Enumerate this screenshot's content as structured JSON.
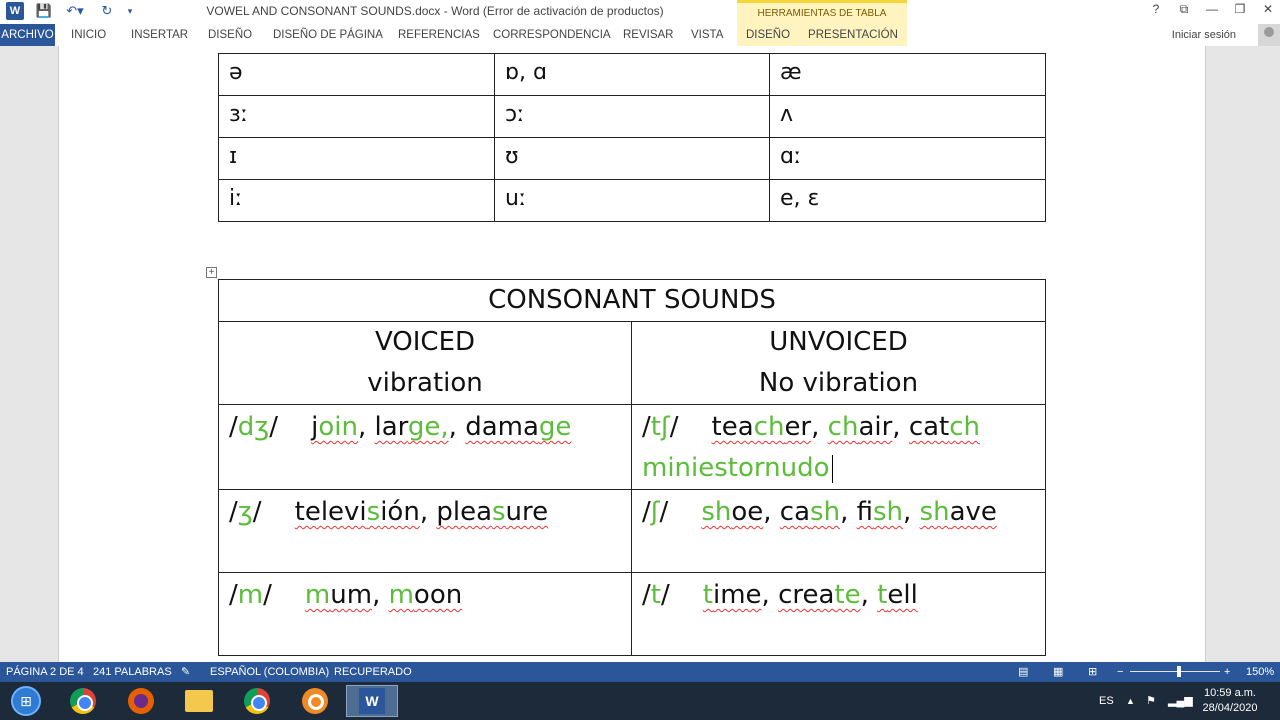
{
  "window": {
    "title": "VOWEL AND CONSONANT SOUNDS.docx - Word (Error de activación de productos)",
    "tools_header": "HERRAMIENTAS DE TABLA",
    "controls": [
      "?",
      "⧉",
      "—",
      "❐",
      "✕"
    ]
  },
  "ribbon": {
    "tabs": [
      "ARCHIVO",
      "INICIO",
      "INSERTAR",
      "DISEÑO",
      "DISEÑO DE PÁGINA",
      "REFERENCIAS",
      "CORRESPONDENCIA",
      "REVISAR",
      "VISTA",
      "DISEÑO",
      "PRESENTACIÓN"
    ],
    "signin": "Iniciar sesión"
  },
  "vowel_table": [
    [
      "ə",
      "ɒ, ɑ",
      "æ"
    ],
    [
      "ɜː",
      "ɔː",
      "ʌ"
    ],
    [
      "ɪ",
      "ʊ",
      "ɑː"
    ],
    [
      "iː",
      "uː",
      "e, ɛ"
    ]
  ],
  "consonant_table": {
    "title": "CONSONANT SOUNDS",
    "voiced": {
      "heading": "VOICED",
      "sub": "vibration"
    },
    "unvoiced": {
      "heading": "UNVOICED",
      "sub": "No vibration"
    },
    "rows": [
      {
        "left": {
          "symbol": "dʒ",
          "examples": [
            [
              "j",
              "oin"
            ],
            [
              "lar",
              "ge,"
            ],
            [
              "dama",
              "ge"
            ]
          ]
        },
        "right": {
          "symbol": "tʃ",
          "examples": [
            [
              "tea",
              "ch",
              "er"
            ],
            [
              "",
              "ch",
              "air"
            ],
            [
              "cat",
              "ch",
              ""
            ]
          ],
          "extra": "miniestornudo"
        }
      },
      {
        "left": {
          "symbol": "ʒ",
          "examples": [
            [
              "televi",
              "s",
              "ión"
            ],
            [
              "plea",
              "s",
              "ure"
            ]
          ]
        },
        "right": {
          "symbol": "ʃ",
          "examples": [
            [
              "",
              "sh",
              "oe"
            ],
            [
              "ca",
              "sh",
              ""
            ],
            [
              "fi",
              "sh",
              ""
            ],
            [
              "",
              "sh",
              "ave"
            ]
          ]
        }
      },
      {
        "left": {
          "symbol": "m",
          "examples": [
            [
              "",
              "m",
              "um"
            ],
            [
              "",
              "m",
              "oon"
            ]
          ]
        },
        "right": {
          "symbol": "t",
          "examples": [
            [
              "",
              "t",
              "ime"
            ],
            [
              "crea",
              "te",
              ""
            ],
            [
              "",
              "t",
              "ell"
            ]
          ]
        }
      }
    ]
  },
  "statusbar": {
    "page": "PÁGINA 2 DE 4",
    "words": "241 PALABRAS",
    "language": "ESPAÑOL (COLOMBIA)",
    "state": "RECUPERADO",
    "zoom": "150%",
    "zoom_minus": "−",
    "zoom_plus": "+"
  },
  "taskbar": {
    "language": "ES",
    "time": "10:59 a.m.",
    "date": "28/04/2020"
  },
  "colors": {
    "word_blue": "#2b579a",
    "highlight_green": "#5bbd3a",
    "tools_yellow": "#fff4c0"
  }
}
